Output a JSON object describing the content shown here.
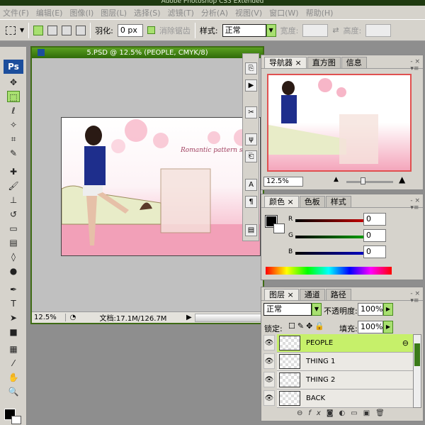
{
  "app": {
    "title": "Adobe Photoshop CS3 Extended"
  },
  "menu": [
    "文件(F)",
    "编辑(E)",
    "图像(I)",
    "图层(L)",
    "选择(S)",
    "滤镜(T)",
    "分析(A)",
    "视图(V)",
    "窗口(W)",
    "帮助(H)"
  ],
  "options": {
    "feather_label": "羽化:",
    "feather_value": "0 px",
    "antialias_label": "消除锯齿",
    "style_label": "样式:",
    "style_value": "正常",
    "width_label": "宽度:",
    "height_label": "高度:"
  },
  "toolbox": {
    "logo": "Ps"
  },
  "document": {
    "title": "5.PSD @ 12.5% (PEOPLE, CMYK/8)",
    "zoom": "12.5%",
    "doc_info": "文档:17.1M/126.7M",
    "image_text": "Romantic pattern style"
  },
  "navigator": {
    "tabs": [
      "导航器",
      "直方图",
      "信息"
    ],
    "zoom": "12.5%"
  },
  "color": {
    "tabs": [
      "颜色",
      "色板",
      "样式"
    ],
    "channels": [
      {
        "label": "R",
        "value": "0",
        "color": "#d01010"
      },
      {
        "label": "G",
        "value": "0",
        "color": "#10b010"
      },
      {
        "label": "B",
        "value": "0",
        "color": "#1010c0"
      }
    ]
  },
  "layers": {
    "tabs": [
      "图层",
      "通道",
      "路径"
    ],
    "blend": "正常",
    "opacity_label": "不透明度:",
    "opacity": "100%",
    "lock_label": "锁定:",
    "fill_label": "填充:",
    "fill": "100%",
    "items": [
      {
        "name": "PEOPLE",
        "selected": true
      },
      {
        "name": "THING 1"
      },
      {
        "name": "THING 2"
      },
      {
        "name": "BACK"
      }
    ]
  },
  "accent": "#c6f06a"
}
